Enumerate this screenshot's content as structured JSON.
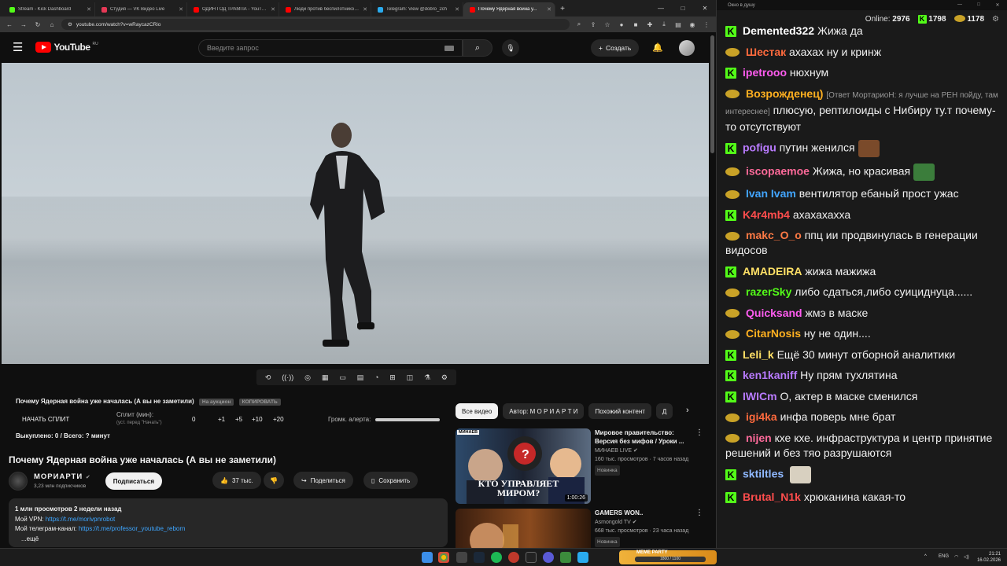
{
  "browser": {
    "tabs": [
      {
        "title": "Stream - Kick Dashboard",
        "color": "#53fc18"
      },
      {
        "title": "Студия — VK Видео Live",
        "color": "#e63956"
      },
      {
        "title": "ОДИН ГОД ТРАМПА - YouTub...",
        "color": "#ff0000"
      },
      {
        "title": "Люди против беспилотников...",
        "color": "#ff0000"
      },
      {
        "title": "Telegram: View @dobro_2ch",
        "color": "#2aabee"
      },
      {
        "title": "Почему Ядерная война у...",
        "color": "#ff0000",
        "active": true
      }
    ],
    "url": "youtube.com/watch?v=wRaycazCRio"
  },
  "youtube": {
    "logo_text": "YouTube",
    "logo_region": "RU",
    "search_placeholder": "Введите запрос",
    "create_label": "Создать",
    "extension": {
      "title": "Почему Ядерная война уже началась (А вы не заметили)",
      "pill1": "На аукцион",
      "pill2": "КОПИРОВАТЬ",
      "split_label": "НАЧАТЬ СПЛИТ",
      "split_min_label": "Сплит (мин):",
      "split_hint": "(уст. перед \"Начать\")",
      "split_value": "0",
      "inc1": "+1",
      "inc5": "+5",
      "inc10": "+10",
      "inc20": "+20",
      "alert_volume_label": "Громк. алерта:",
      "bought": "Выкуплено: 0 / Всего: ? минут"
    },
    "video_title": "Почему Ядерная война уже началась (А вы не заметили)",
    "channel_name": "МОРИАРТИ",
    "subscribers": "3,23 млн подписчиков",
    "subscribe_label": "Подписаться",
    "likes": "37 тыс.",
    "share_label": "Поделиться",
    "save_label": "Сохранить",
    "description": {
      "stats": "1 млн просмотров  2 недели назад",
      "vpn_label": "Мой VPN: ",
      "vpn_link": "https://t.me/morivpnrobot",
      "tg_label": "Мой телеграм-канал: ",
      "tg_link": "https://t.me/professor_youtube_reborn",
      "more": "...ещё"
    },
    "chips": [
      "Все видео",
      "Автор: М О Р И А Р Т И",
      "Похожий контент",
      "Д"
    ],
    "recommendations": [
      {
        "title": "Мировое правительство: Версия без мифов / Уроки ...",
        "channel": "МИНАЕВ LIVE",
        "meta": "160 тыс. просмотров · 7 часов назад",
        "badge": "Новинка",
        "duration": "1:00:26",
        "thumb_caption": "КТО УПРАВЛЯЕТ МИРОМ?",
        "thumb_tag": "МИНАЕВ"
      },
      {
        "title": "GAMERS WON..",
        "channel": "Asmongold TV",
        "meta": "668 тыс. просмотров · 23 часа назад",
        "badge": "Новинка"
      }
    ]
  },
  "chat": {
    "window_title": "Окно в душу",
    "online_label": "Online:",
    "online_count": "2976",
    "kick_count": "1798",
    "vk_count": "1178",
    "messages": [
      {
        "platform": "kick",
        "user": "Demented322",
        "color": "#ffffff",
        "text": "Жижа да"
      },
      {
        "platform": "vk",
        "user": "Шестак",
        "color": "#ff6a3d",
        "text": "ахахах ну и кринж"
      },
      {
        "platform": "kick",
        "user": "ipetrooo",
        "color": "#ff5cf0",
        "text": "нюхнум"
      },
      {
        "platform": "vk",
        "user": "Возрожденец)",
        "color": "#ffb020",
        "reply": "[Ответ МортариоН: я лучше на РЕН пойду, там интереснее]",
        "text": "плюсую, рептилоиды с Нибиру ту.т почему-то отсутствуют"
      },
      {
        "platform": "kick",
        "user": "pofigu",
        "color": "#b97bff",
        "text": "путин женился",
        "emote": "#7a4a2a"
      },
      {
        "platform": "vk",
        "user": "iscopaemoe",
        "color": "#ff6a9a",
        "text": "Жижа, но красивая",
        "emote": "#3b7d3b"
      },
      {
        "platform": "vk",
        "user": "Ivan Ivam",
        "color": "#42a5ff",
        "text": "вентилятор ебаный прост ужас"
      },
      {
        "platform": "kick",
        "user": "K4r4mb4",
        "color": "#ff4d4d",
        "text": "ахахахахха"
      },
      {
        "platform": "vk",
        "user": "makc_O_o",
        "color": "#ff7a45",
        "text": "ппц ии продвинулась в генерации видосов"
      },
      {
        "platform": "kick",
        "user": "AMADEIRA",
        "color": "#ffe066",
        "text": "жижа мажижа"
      },
      {
        "platform": "vk",
        "user": "razerSky",
        "color": "#53fc18",
        "text": "либо сдаться,либо суициднуца......"
      },
      {
        "platform": "vk",
        "user": "Quicksand",
        "color": "#ff5cf0",
        "text": "жмэ в маске"
      },
      {
        "platform": "vk",
        "user": "CitarNosis",
        "color": "#ffb020",
        "text": "ну не один...."
      },
      {
        "platform": "kick",
        "user": "Leli_k",
        "color": "#ffe066",
        "text": "Ещё 30 минут отборной аналитики"
      },
      {
        "platform": "kick",
        "user": "ken1kaniff",
        "color": "#b97bff",
        "text": "Ну прям тухлятина"
      },
      {
        "platform": "kick",
        "user": "IWICm",
        "color": "#b97bff",
        "text": "О, актер в маске сменился"
      },
      {
        "platform": "vk",
        "user": "igi4ka",
        "color": "#ff6a3d",
        "text": "инфа поверь мне брат"
      },
      {
        "platform": "vk",
        "user": "nijen",
        "color": "#ff6a9a",
        "text": "кхе кхе. инфраструктура и центр принятие решений и без тяо разрушаются"
      },
      {
        "platform": "kick",
        "user": "sktiltles",
        "color": "#8fb8ff",
        "text": "",
        "emote": "#d8d0c0"
      },
      {
        "platform": "kick",
        "user": "Brutal_N1k",
        "color": "#ff4d4d",
        "text": "хрюканина какая-то"
      }
    ]
  },
  "taskbar": {
    "lang": "ENG",
    "time": "21:21",
    "date": "16.02.2026",
    "widget_title": "MEME PARTY",
    "widget_progress": "1800 / 1100"
  }
}
